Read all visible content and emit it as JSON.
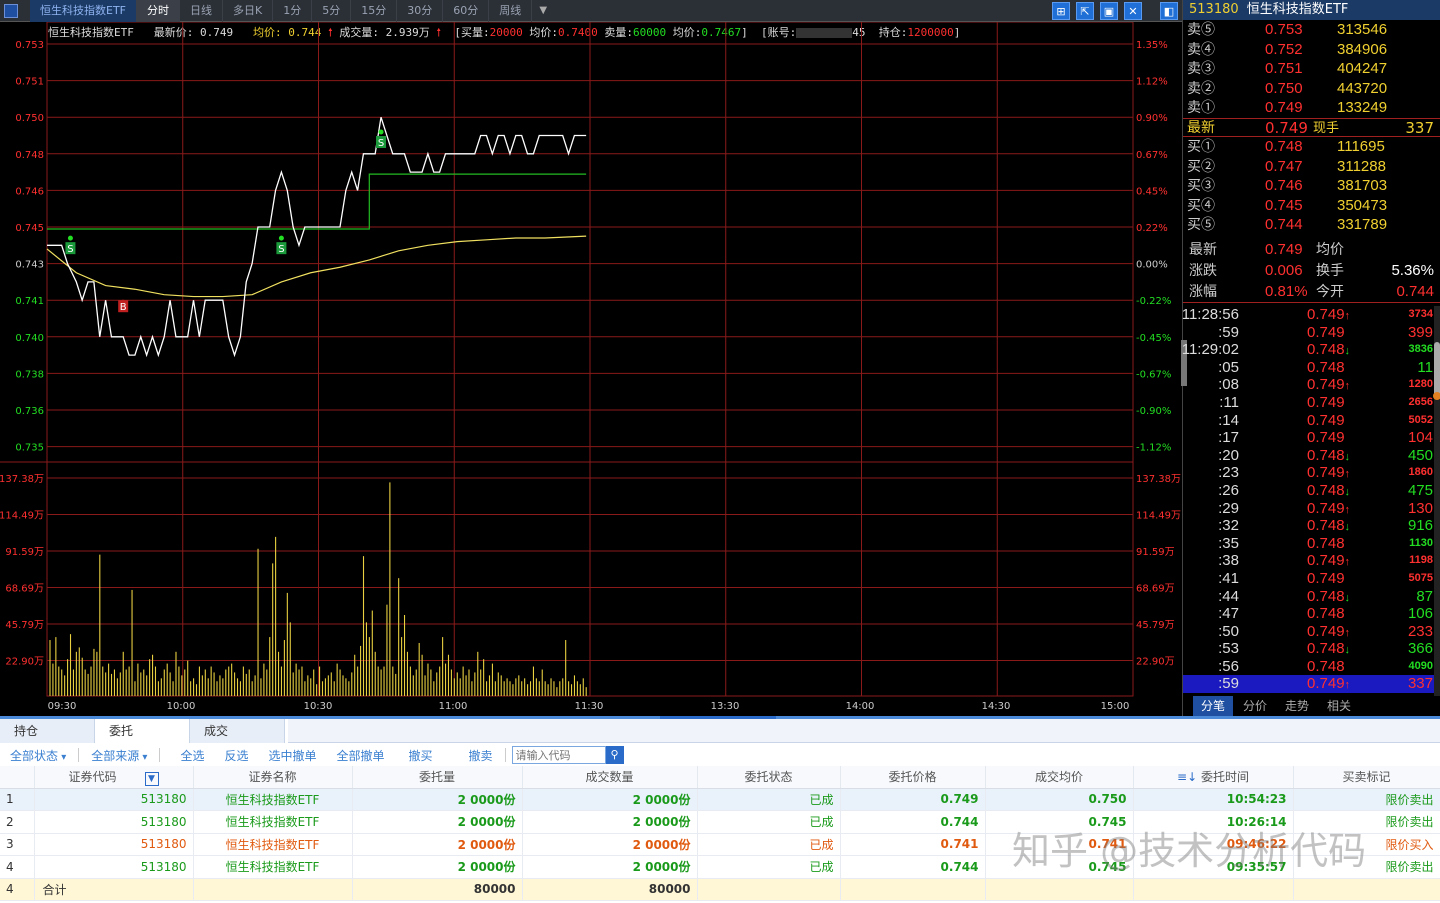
{
  "topbar": {
    "stock_tab": "恒生科技指数ETF",
    "periods": [
      "分时",
      "日线",
      "多日K",
      "1分",
      "5分",
      "15分",
      "30分",
      "60分",
      "周线"
    ],
    "active_period": "分时"
  },
  "info": {
    "name": "恒生科技指数ETF",
    "last_label": "最新价:",
    "last_value": "0.749",
    "avg_label": "均价:",
    "avg_value": "0.744",
    "vol_label": "成交量:",
    "vol_value": "2.939万",
    "buy_label": "[买量:",
    "buy_qty": "20000",
    "buy_avg_label": "均价:",
    "buy_avg": "0.7400",
    "sell_label": "卖量:",
    "sell_qty": "60000",
    "sell_avg_label": "均价:",
    "sell_avg": "0.7467",
    "close1": "]",
    "acct_label": "[账号:",
    "acct_tail": "45",
    "pos_label": "持仓:",
    "pos_value": "1200000",
    "close2": "]"
  },
  "chart_data": {
    "type": "line",
    "price_ticks_left": [
      "0.753",
      "0.751",
      "0.750",
      "0.748",
      "0.746",
      "0.745",
      "0.743",
      "0.741",
      "0.740",
      "0.738",
      "0.736",
      "0.735"
    ],
    "pct_ticks_right": [
      "1.35%",
      "1.12%",
      "0.90%",
      "0.67%",
      "0.45%",
      "0.22%",
      "0.00%",
      "-0.22%",
      "-0.45%",
      "-0.67%",
      "-0.90%",
      "-1.12%"
    ],
    "vol_ticks": [
      "137.38万",
      "114.49万",
      "91.59万",
      "68.69万",
      "45.79万",
      "22.90万"
    ],
    "time_ticks": [
      "09:30",
      "10:00",
      "10:30",
      "11:00",
      "11:30",
      "13:30",
      "14:00",
      "14:30",
      "15:00"
    ],
    "price_range": [
      0.7348,
      0.7532
    ],
    "prev_close": 0.743,
    "price_series": [
      [
        0,
        0.744
      ],
      [
        5,
        0.744
      ],
      [
        7,
        0.743
      ],
      [
        10,
        0.742
      ],
      [
        12,
        0.741
      ],
      [
        14,
        0.742
      ],
      [
        16,
        0.742
      ],
      [
        18,
        0.74
      ],
      [
        20,
        0.741
      ],
      [
        22,
        0.74
      ],
      [
        24,
        0.74
      ],
      [
        26,
        0.74
      ],
      [
        28,
        0.739
      ],
      [
        30,
        0.739
      ],
      [
        32,
        0.74
      ],
      [
        34,
        0.739
      ],
      [
        36,
        0.74
      ],
      [
        38,
        0.739
      ],
      [
        40,
        0.74
      ],
      [
        42,
        0.741
      ],
      [
        44,
        0.74
      ],
      [
        46,
        0.74
      ],
      [
        48,
        0.74
      ],
      [
        50,
        0.741
      ],
      [
        52,
        0.74
      ],
      [
        54,
        0.741
      ],
      [
        56,
        0.741
      ],
      [
        58,
        0.741
      ],
      [
        60,
        0.741
      ],
      [
        62,
        0.74
      ],
      [
        64,
        0.739
      ],
      [
        66,
        0.74
      ],
      [
        68,
        0.742
      ],
      [
        70,
        0.743
      ],
      [
        72,
        0.745
      ],
      [
        74,
        0.745
      ],
      [
        76,
        0.745
      ],
      [
        78,
        0.746
      ],
      [
        80,
        0.747
      ],
      [
        82,
        0.746
      ],
      [
        84,
        0.745
      ],
      [
        86,
        0.744
      ],
      [
        88,
        0.745
      ],
      [
        90,
        0.745
      ],
      [
        92,
        0.745
      ],
      [
        94,
        0.745
      ],
      [
        96,
        0.745
      ],
      [
        98,
        0.745
      ],
      [
        100,
        0.745
      ],
      [
        102,
        0.746
      ],
      [
        104,
        0.747
      ],
      [
        106,
        0.746
      ],
      [
        108,
        0.748
      ],
      [
        110,
        0.748
      ],
      [
        112,
        0.748
      ],
      [
        114,
        0.75
      ],
      [
        116,
        0.749
      ],
      [
        118,
        0.748
      ],
      [
        120,
        0.748
      ],
      [
        122,
        0.748
      ],
      [
        124,
        0.747
      ],
      [
        126,
        0.747
      ],
      [
        128,
        0.747
      ],
      [
        130,
        0.748
      ],
      [
        132,
        0.747
      ],
      [
        134,
        0.747
      ],
      [
        136,
        0.748
      ],
      [
        138,
        0.748
      ],
      [
        140,
        0.748
      ],
      [
        142,
        0.748
      ],
      [
        144,
        0.748
      ],
      [
        146,
        0.748
      ],
      [
        148,
        0.749
      ],
      [
        150,
        0.749
      ],
      [
        152,
        0.748
      ],
      [
        154,
        0.749
      ],
      [
        156,
        0.749
      ],
      [
        158,
        0.748
      ],
      [
        160,
        0.749
      ],
      [
        162,
        0.749
      ],
      [
        164,
        0.748
      ],
      [
        166,
        0.748
      ],
      [
        168,
        0.749
      ],
      [
        170,
        0.749
      ],
      [
        172,
        0.749
      ],
      [
        174,
        0.749
      ],
      [
        176,
        0.749
      ],
      [
        178,
        0.748
      ],
      [
        180,
        0.749
      ],
      [
        182,
        0.749
      ],
      [
        184,
        0.749
      ]
    ],
    "avg_series": [
      [
        0,
        0.7438
      ],
      [
        10,
        0.7425
      ],
      [
        20,
        0.7418
      ],
      [
        30,
        0.7416
      ],
      [
        40,
        0.7413
      ],
      [
        50,
        0.7412
      ],
      [
        60,
        0.7412
      ],
      [
        70,
        0.7413
      ],
      [
        80,
        0.742
      ],
      [
        90,
        0.7425
      ],
      [
        100,
        0.7428
      ],
      [
        110,
        0.7432
      ],
      [
        120,
        0.7437
      ],
      [
        130,
        0.744
      ],
      [
        140,
        0.7442
      ],
      [
        150,
        0.7443
      ],
      [
        160,
        0.7444
      ],
      [
        170,
        0.7444
      ],
      [
        184,
        0.7445
      ]
    ],
    "position_line": [
      [
        0,
        0.745
      ],
      [
        110,
        0.745
      ],
      [
        110,
        0.747
      ],
      [
        184,
        0.747
      ]
    ],
    "markers": [
      {
        "t": 8,
        "price": 0.7445,
        "label": "S",
        "kind": "sell"
      },
      {
        "t": 26,
        "price": 0.741,
        "label": "B",
        "kind": "buy"
      },
      {
        "t": 80,
        "price": 0.7445,
        "label": "S",
        "kind": "sell"
      },
      {
        "t": 114,
        "price": 0.7493,
        "label": "S",
        "kind": "sell"
      }
    ],
    "volume_max_wan": 148,
    "volume_wan": [
      38,
      22,
      40,
      20,
      18,
      14,
      25,
      42,
      18,
      30,
      33,
      26,
      18,
      15,
      20,
      32,
      30,
      96,
      20,
      16,
      22,
      15,
      18,
      12,
      16,
      30,
      18,
      20,
      72,
      10,
      22,
      16,
      18,
      14,
      25,
      28,
      20,
      10,
      12,
      18,
      22,
      16,
      10,
      30,
      20,
      14,
      18,
      24,
      10,
      12,
      8,
      20,
      14,
      18,
      12,
      20,
      16,
      10,
      14,
      12,
      18,
      20,
      22,
      16,
      12,
      10,
      20,
      15,
      18,
      10,
      14,
      100,
      12,
      22,
      18,
      40,
      90,
      108,
      30,
      20,
      38,
      70,
      50,
      16,
      22,
      18,
      20,
      10,
      14,
      12,
      18,
      8,
      20,
      10,
      12,
      14,
      16,
      10,
      22,
      18,
      14,
      12,
      10,
      16,
      28,
      20,
      34,
      95,
      50,
      40,
      58,
      30,
      20,
      18,
      20,
      62,
      145,
      20,
      15,
      80,
      40,
      55,
      30,
      20,
      14,
      18,
      36,
      28,
      14,
      22,
      18,
      10,
      16,
      20,
      40,
      22,
      28,
      18,
      12,
      16,
      12,
      20,
      14,
      18,
      10,
      16,
      30,
      18,
      25,
      10,
      14,
      22,
      10,
      16,
      14,
      10,
      12,
      10,
      8,
      12,
      14,
      10,
      12,
      8,
      10,
      20,
      12,
      10,
      18,
      10,
      8,
      12,
      10,
      6,
      10,
      12,
      38,
      10,
      8,
      14,
      10,
      8,
      12,
      6
    ]
  },
  "quote": {
    "code": "513180",
    "name": "恒生科技指数ETF",
    "asks": [
      {
        "label": "卖⑤",
        "price": "0.753",
        "vol": "313546"
      },
      {
        "label": "卖④",
        "price": "0.752",
        "vol": "384906"
      },
      {
        "label": "卖③",
        "price": "0.751",
        "vol": "404247"
      },
      {
        "label": "卖②",
        "price": "0.750",
        "vol": "443720"
      },
      {
        "label": "卖①",
        "price": "0.749",
        "vol": "133249"
      }
    ],
    "last": {
      "label": "最新",
      "price": "0.749",
      "label2": "现手",
      "vol": "337"
    },
    "bids": [
      {
        "label": "买①",
        "price": "0.748",
        "vol": "111695"
      },
      {
        "label": "买②",
        "price": "0.747",
        "vol": "311288"
      },
      {
        "label": "买③",
        "price": "0.746",
        "vol": "381703"
      },
      {
        "label": "买④",
        "price": "0.745",
        "vol": "350473"
      },
      {
        "label": "买⑤",
        "price": "0.744",
        "vol": "331789"
      }
    ],
    "stats": [
      {
        "k": "最新",
        "v": "0.749",
        "k2": "均价",
        "v2": ""
      },
      {
        "k": "涨跌",
        "v": "0.006",
        "k2": "换手",
        "v2": "5.36%"
      },
      {
        "k": "涨幅",
        "v": "0.81%",
        "k2": "今开",
        "v2": "0.744"
      }
    ]
  },
  "ticks": [
    {
      "t": "11:28:56",
      "p": "0.749",
      "arrow": "up",
      "v": "3734"
    },
    {
      "t": ":59",
      "p": "0.749",
      "arrow": "",
      "v": "399"
    },
    {
      "t": "11:29:02",
      "p": "0.748",
      "arrow": "down",
      "v": "3836"
    },
    {
      "t": ":05",
      "p": "0.748",
      "arrow": "",
      "v": "11"
    },
    {
      "t": ":08",
      "p": "0.749",
      "arrow": "up",
      "v": "1280"
    },
    {
      "t": ":11",
      "p": "0.749",
      "arrow": "",
      "v": "2656"
    },
    {
      "t": ":14",
      "p": "0.749",
      "arrow": "",
      "v": "5052"
    },
    {
      "t": ":17",
      "p": "0.749",
      "arrow": "",
      "v": "104"
    },
    {
      "t": ":20",
      "p": "0.748",
      "arrow": "down",
      "v": "450"
    },
    {
      "t": ":23",
      "p": "0.749",
      "arrow": "up",
      "v": "1860"
    },
    {
      "t": ":26",
      "p": "0.748",
      "arrow": "down",
      "v": "475"
    },
    {
      "t": ":29",
      "p": "0.749",
      "arrow": "up",
      "v": "130"
    },
    {
      "t": ":32",
      "p": "0.748",
      "arrow": "down",
      "v": "916"
    },
    {
      "t": ":35",
      "p": "0.748",
      "arrow": "",
      "v": "1130"
    },
    {
      "t": ":38",
      "p": "0.749",
      "arrow": "up",
      "v": "1198"
    },
    {
      "t": ":41",
      "p": "0.749",
      "arrow": "",
      "v": "5075"
    },
    {
      "t": ":44",
      "p": "0.748",
      "arrow": "down",
      "v": "87"
    },
    {
      "t": ":47",
      "p": "0.748",
      "arrow": "",
      "v": "106"
    },
    {
      "t": ":50",
      "p": "0.749",
      "arrow": "up",
      "v": "233"
    },
    {
      "t": ":53",
      "p": "0.748",
      "arrow": "down",
      "v": "366"
    },
    {
      "t": ":56",
      "p": "0.748",
      "arrow": "",
      "v": "4090"
    },
    {
      "t": ":59",
      "p": "0.749",
      "arrow": "up",
      "v": "337"
    }
  ],
  "right_tabs": [
    "分笔",
    "分价",
    "走势",
    "相关"
  ],
  "bottom": {
    "tabs": [
      "持仓",
      "委托",
      "成交"
    ],
    "active_tab": "委托",
    "toolbar": {
      "all_status": "全部状态",
      "all_source": "全部来源",
      "select_all": "全选",
      "invert": "反选",
      "cancel_selected": "选中撤单",
      "cancel_all": "全部撤单",
      "cancel_buy": "撤买",
      "cancel_sell": "撤卖",
      "search_placeholder": "请输入代码"
    },
    "columns": [
      "",
      "证券代码",
      "证券名称",
      "委托量",
      "成交数量",
      "委托状态",
      "委托价格",
      "成交均价",
      "委托时间",
      "买卖标记"
    ],
    "rows": [
      {
        "idx": "1",
        "code": "513180",
        "name": "恒生科技指数ETF",
        "qty": "2 0000份",
        "filled": "2 0000份",
        "status": "已成",
        "price": "0.749",
        "avg": "0.750",
        "time": "10:54:23",
        "side": "限价卖出",
        "kind": "sell"
      },
      {
        "idx": "2",
        "code": "513180",
        "name": "恒生科技指数ETF",
        "qty": "2 0000份",
        "filled": "2 0000份",
        "status": "已成",
        "price": "0.744",
        "avg": "0.745",
        "time": "10:26:14",
        "side": "限价卖出",
        "kind": "sell"
      },
      {
        "idx": "3",
        "code": "513180",
        "name": "恒生科技指数ETF",
        "qty": "2 0000份",
        "filled": "2 0000份",
        "status": "已成",
        "price": "0.741",
        "avg": "0.741",
        "time": "09:46:22",
        "side": "限价买入",
        "kind": "buy"
      },
      {
        "idx": "4",
        "code": "513180",
        "name": "恒生科技指数ETF",
        "qty": "2 0000份",
        "filled": "2 0000份",
        "status": "已成",
        "price": "0.744",
        "avg": "0.745",
        "time": "09:35:57",
        "side": "限价卖出",
        "kind": "sell"
      }
    ],
    "total": {
      "idx": "4",
      "label": "合计",
      "qty": "80000",
      "filled": "80000"
    }
  },
  "watermark": "知乎 @技术分析代码",
  "colors": {
    "up": "#ff3030",
    "down": "#22dd22",
    "grid": "#8a1a1a",
    "price_line": "#ffffff",
    "avg_line": "#f0e060",
    "position_line": "#22bb22",
    "volume": "#e8d040"
  }
}
